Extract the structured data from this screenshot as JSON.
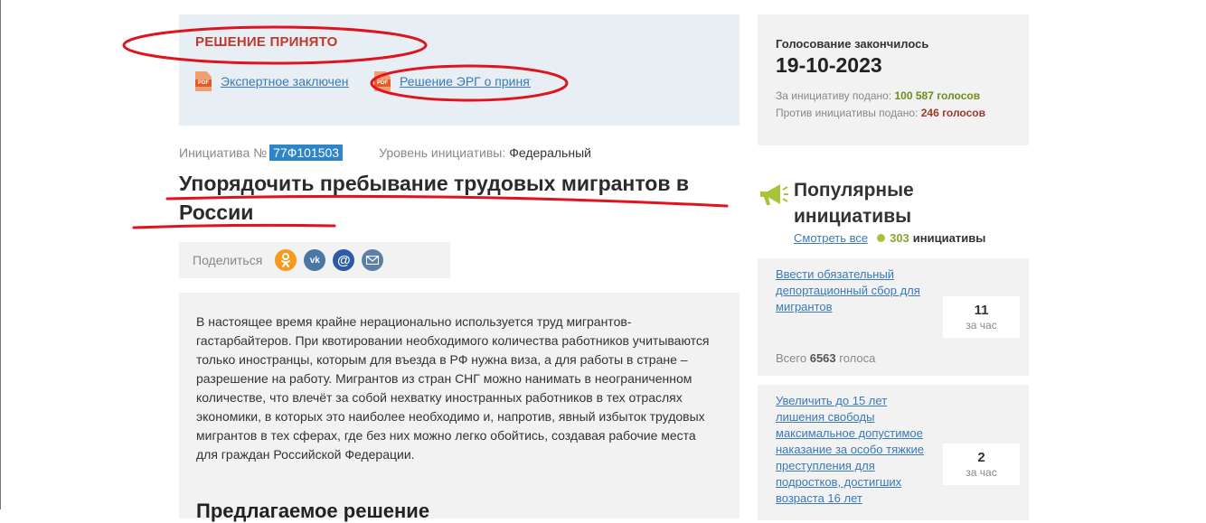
{
  "decision": {
    "status": "РЕШЕНИЕ ПРИНЯТО",
    "docs": [
      {
        "label": "Экспертное заключение"
      },
      {
        "label": "Решение ЭРГ о принятии"
      }
    ],
    "pdf_icon_text": "PDF"
  },
  "initiative": {
    "number_label": "Инициатива №",
    "number": "77Ф101503",
    "level_label": "Уровень инициативы:",
    "level_value": "Федеральный",
    "title": "Упорядочить пребывание трудовых мигрантов в России"
  },
  "share": {
    "label": "Поделиться",
    "icons": [
      "odnoklassniki-icon",
      "vk-icon",
      "email-at-icon",
      "envelope-icon"
    ]
  },
  "description": {
    "text": "В настоящее время крайне нерационально используется труд мигрантов-гастарбайтеров. При квотировании необходимого количества работников учитываются только иностранцы, которым для въезда в РФ нужна виза, а для работы в стране – разрешение на работу. Мигрантов из стран СНГ можно нанимать в неограниченном количестве, что влечёт за собой нехватку иностранных работников в тех отраслях экономики, в которых это наиболее необходимо и, напротив, явный избыток трудовых мигрантов в тех сферах, где без них можно легко обойтись, создавая рабочие места для граждан Российской Федерации.",
    "next_heading": "Предлагаемое решение"
  },
  "voting": {
    "ended_label": "Голосование закончилось",
    "date": "19-10-2023",
    "for_label": "За инициативу подано:",
    "for_value": "100 587 голосов",
    "against_label": "Против инициативы подано:",
    "against_value": "246 голосов"
  },
  "popular": {
    "title": "Популярные инициативы",
    "see_all": "Смотреть все",
    "count": "303",
    "count_word": "инициативы",
    "items": [
      {
        "title": "Ввести обязательный депортационный сбор для мигрантов",
        "rate": "11",
        "rate_unit": "за час",
        "total_label": "Всего",
        "total": "6563",
        "total_word": "голоса"
      },
      {
        "title": "Увеличить до 15 лет лишения свободы максимальное допустимое наказание за особо тяжкие преступления для подростков, достигших возраста 16 лет",
        "rate": "2",
        "rate_unit": "за час"
      }
    ]
  },
  "colors": {
    "accent_blue": "#2d85c8",
    "link": "#3a7ab8",
    "decision_red": "#c0392b",
    "annotation_red": "#e0141e",
    "votes_for": "#6f8c1c",
    "votes_against": "#9a3a2a"
  }
}
